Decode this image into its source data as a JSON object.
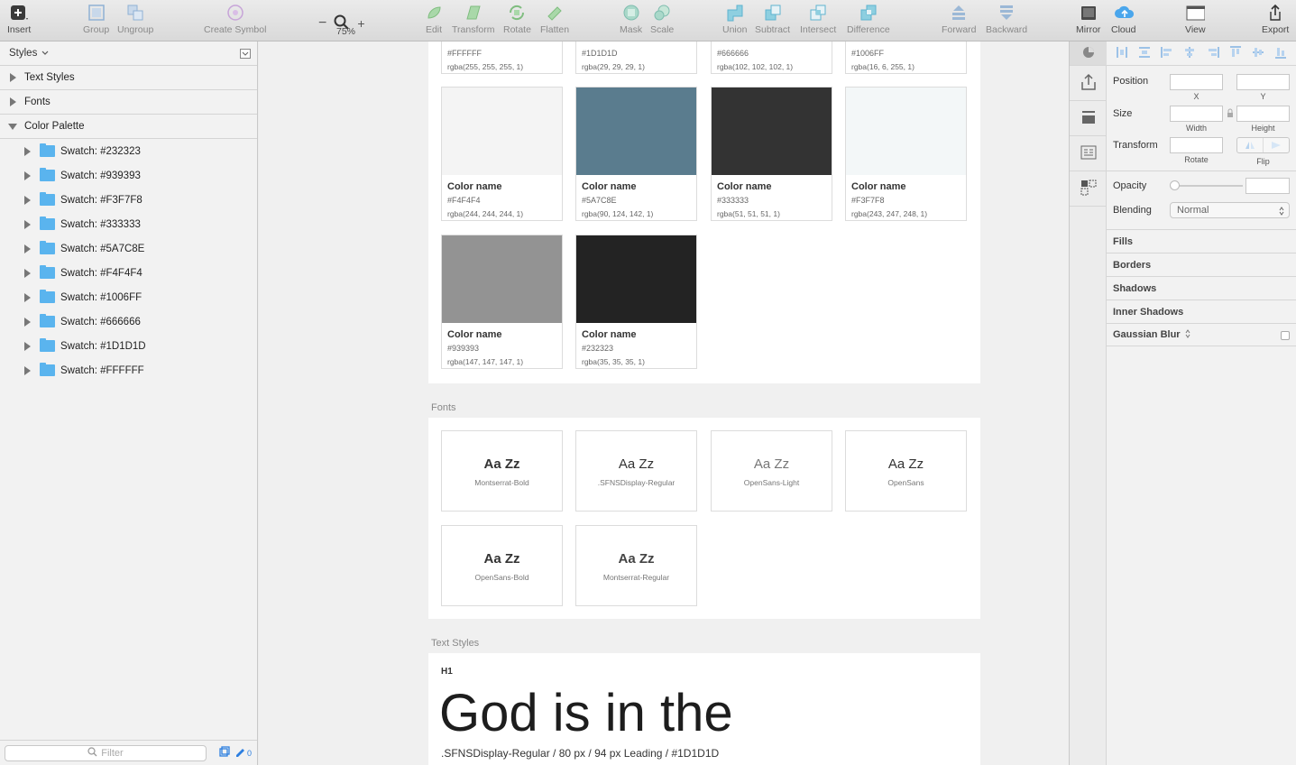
{
  "toolbar": {
    "insert": "Insert",
    "group": "Group",
    "ungroup": "Ungroup",
    "create_symbol": "Create Symbol",
    "zoom": "75%",
    "edit": "Edit",
    "transform": "Transform",
    "rotate": "Rotate",
    "flatten": "Flatten",
    "mask": "Mask",
    "scale": "Scale",
    "union": "Union",
    "subtract": "Subtract",
    "intersect": "Intersect",
    "difference": "Difference",
    "forward": "Forward",
    "backward": "Backward",
    "mirror": "Mirror",
    "cloud": "Cloud",
    "view": "View",
    "export": "Export"
  },
  "sidebar": {
    "title": "Styles",
    "groups": [
      "Text Styles",
      "Fonts",
      "Color Palette"
    ],
    "items": [
      "Swatch: #232323",
      "Swatch: #939393",
      "Swatch: #F3F7F8",
      "Swatch: #333333",
      "Swatch: #5A7C8E",
      "Swatch: #F4F4F4",
      "Swatch: #1006FF",
      "Swatch: #666666",
      "Swatch: #1D1D1D",
      "Swatch: #FFFFFF"
    ],
    "filter_placeholder": "Filter",
    "count": "0"
  },
  "top_swatches": [
    {
      "hex": "#FFFFFF",
      "rgba": "rgba(255, 255, 255, 1)"
    },
    {
      "hex": "#1D1D1D",
      "rgba": "rgba(29, 29, 29, 1)"
    },
    {
      "hex": "#666666",
      "rgba": "rgba(102, 102, 102, 1)"
    },
    {
      "hex": "#1006FF",
      "rgba": "rgba(16, 6, 255, 1)"
    }
  ],
  "swatches": [
    {
      "name": "Color name",
      "hex": "#F4F4F4",
      "rgba": "rgba(244, 244, 244, 1)",
      "color": "#F4F4F4"
    },
    {
      "name": "Color name",
      "hex": "#5A7C8E",
      "rgba": "rgba(90, 124, 142, 1)",
      "color": "#5A7C8E"
    },
    {
      "name": "Color name",
      "hex": "#333333",
      "rgba": "rgba(51, 51, 51, 1)",
      "color": "#333333"
    },
    {
      "name": "Color name",
      "hex": "#F3F7F8",
      "rgba": "rgba(243, 247, 248, 1)",
      "color": "#F3F7F8"
    },
    {
      "name": "Color name",
      "hex": "#939393",
      "rgba": "rgba(147, 147, 147, 1)",
      "color": "#939393"
    },
    {
      "name": "Color name",
      "hex": "#232323",
      "rgba": "rgba(35, 35, 35, 1)",
      "color": "#232323"
    }
  ],
  "fonts_label": "Fonts",
  "fonts": [
    {
      "sample": "Aa Zz",
      "name": "Montserrat-Bold"
    },
    {
      "sample": "Aa Zz",
      "name": ".SFNSDisplay-Regular"
    },
    {
      "sample": "Aa Zz",
      "name": "OpenSans-Light"
    },
    {
      "sample": "Aa Zz",
      "name": "OpenSans"
    },
    {
      "sample": "Aa Zz",
      "name": "OpenSans-Bold"
    },
    {
      "sample": "Aa Zz",
      "name": "Montserrat-Regular"
    }
  ],
  "text_styles_label": "Text Styles",
  "text_style": {
    "tag": "H1",
    "sample": "God is in the",
    "spec": ".SFNSDisplay-Regular / 80 px / 94 px Leading / #1D1D1D"
  },
  "inspector": {
    "position": "Position",
    "x": "X",
    "y": "Y",
    "size": "Size",
    "width": "Width",
    "height": "Height",
    "transform": "Transform",
    "rotate": "Rotate",
    "flip": "Flip",
    "opacity": "Opacity",
    "blending": "Blending",
    "blend_value": "Normal",
    "sections": [
      "Fills",
      "Borders",
      "Shadows",
      "Inner Shadows",
      "Gaussian Blur"
    ]
  }
}
